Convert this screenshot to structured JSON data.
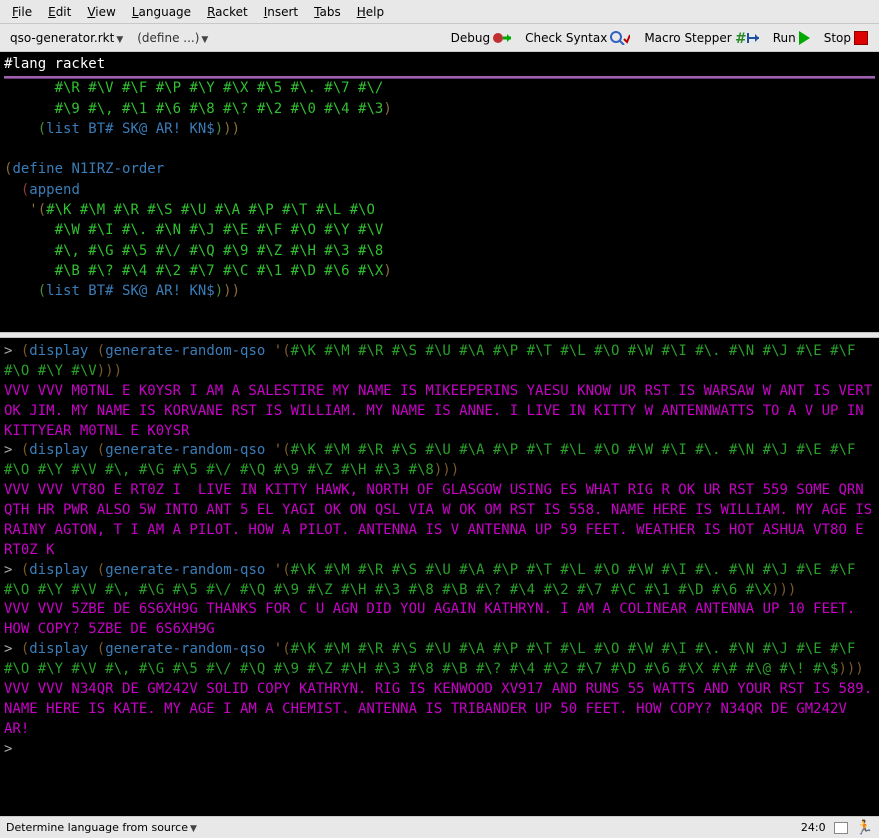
{
  "menubar": {
    "items": [
      {
        "label": "File",
        "accel": "F"
      },
      {
        "label": "Edit",
        "accel": "E"
      },
      {
        "label": "View",
        "accel": "V"
      },
      {
        "label": "Language",
        "accel": "L"
      },
      {
        "label": "Racket",
        "accel": "R"
      },
      {
        "label": "Insert",
        "accel": "I"
      },
      {
        "label": "Tabs",
        "accel": "T"
      },
      {
        "label": "Help",
        "accel": "H"
      }
    ]
  },
  "toolbar": {
    "filename": "qso-generator.rkt",
    "definitions_picker": "(define ...)",
    "buttons": {
      "debug": "Debug",
      "check_syntax": "Check Syntax",
      "macro_stepper": "Macro Stepper",
      "run": "Run",
      "stop": "Stop"
    }
  },
  "definitions": {
    "hashlang": "#lang racket",
    "lines": [
      {
        "indent": "      ",
        "chars": "#\\R #\\V #\\F #\\P #\\Y #\\X #\\5 #\\. #\\7 #\\/"
      },
      {
        "indent": "      ",
        "chars": "#\\9 #\\, #\\1 #\\6 #\\8 #\\? #\\2 #\\0 #\\4 #\\3",
        "close": ")"
      },
      {
        "indent": "    ",
        "listcall": "(list BT# SK@ AR! KN$)",
        "close": "))"
      },
      {
        "blank": true
      },
      {
        "define_open": "(",
        "define_kw": "define",
        "define_id": " N1IRZ-order"
      },
      {
        "indent": "  ",
        "append_open": "(",
        "append_kw": "append"
      },
      {
        "indent": "   ",
        "quote": "'(",
        "chars": "#\\K #\\M #\\R #\\S #\\U #\\A #\\P #\\T #\\L #\\O"
      },
      {
        "indent": "      ",
        "chars": "#\\W #\\I #\\. #\\N #\\J #\\E #\\F #\\O #\\Y #\\V"
      },
      {
        "indent": "      ",
        "chars": "#\\, #\\G #\\5 #\\/ #\\Q #\\9 #\\Z #\\H #\\3 #\\8"
      },
      {
        "indent": "      ",
        "chars": "#\\B #\\? #\\4 #\\2 #\\7 #\\C #\\1 #\\D #\\6 #\\X",
        "close": ")"
      },
      {
        "indent": "    ",
        "listcall": "(list BT# SK@ AR! KN$)",
        "close": "))"
      }
    ]
  },
  "interactions": {
    "entries": [
      {
        "input_prefix": "(display (generate-random-qso '(",
        "input_chars": "#\\K #\\M #\\R #\\S #\\U #\\A #\\P #\\T #\\L #\\O #\\W #\\I #\\. #\\N #\\J #\\E #\\F #\\O #\\Y #\\V",
        "input_close": ")))",
        "output": "VVV VVV M0TNL E K0YSR I AM A SALESTIRE MY NAME IS MIKEEPERINS YAESU KNOW UR RST IS WARSAW W ANT IS VERT OK JIM. MY NAME IS KORVANE RST IS WILLIAM. MY NAME IS ANNE. I LIVE IN KITTY W ANTENNWATTS TO A V UP IN KITTYEAR M0TNL E K0YSR"
      },
      {
        "input_prefix": "(display (generate-random-qso '(",
        "input_chars": "#\\K #\\M #\\R #\\S #\\U #\\A #\\P #\\T #\\L #\\O #\\W #\\I #\\. #\\N #\\J #\\E #\\F #\\O #\\Y #\\V #\\, #\\G #\\5 #\\/ #\\Q #\\9 #\\Z #\\H #\\3 #\\8",
        "input_close": ")))",
        "output": "VVV VVV VT8O E RT0Z I  LIVE IN KITTY HAWK, NORTH OF GLASGOW USING ES WHAT RIG R OK UR RST 559 SOME QRN QTH HR PWR ALSO 5W INTO ANT 5 EL YAGI OK ON QSL VIA W OK OM RST IS 558. NAME HERE IS WILLIAM. MY AGE IS RAINY AGTON, T I AM A PILOT. HOW A PILOT. ANTENNA IS V ANTENNA UP 59 FEET. WEATHER IS HOT ASHUA VT8O E RT0Z K"
      },
      {
        "input_prefix": "(display (generate-random-qso '(",
        "input_chars": "#\\K #\\M #\\R #\\S #\\U #\\A #\\P #\\T #\\L #\\O #\\W #\\I #\\. #\\N #\\J #\\E #\\F #\\O #\\Y #\\V #\\, #\\G #\\5 #\\/ #\\Q #\\9 #\\Z #\\H #\\3 #\\8 #\\B #\\? #\\4 #\\2 #\\7 #\\C #\\1 #\\D #\\6 #\\X",
        "input_close": ")))",
        "output": "VVV VVV 5ZBE DE 6S6XH9G THANKS FOR C U AGN DID YOU AGAIN KATHRYN. I AM A COLINEAR ANTENNA UP 10 FEET. HOW COPY? 5ZBE DE 6S6XH9G"
      },
      {
        "input_prefix": "(display (generate-random-qso '(",
        "input_chars": "#\\K #\\M #\\R #\\S #\\U #\\A #\\P #\\T #\\L #\\O #\\W #\\I #\\. #\\N #\\J #\\E #\\F #\\O #\\Y #\\V #\\, #\\G #\\5 #\\/ #\\Q #\\9 #\\Z #\\H #\\3 #\\8 #\\B #\\? #\\4 #\\2 #\\7 #\\D #\\6 #\\X #\\# #\\@ #\\! #\\$",
        "input_close": ")))",
        "output": "VVV VVV N34QR DE GM242V SOLID COPY KATHRYN. RIG IS KENWOOD XV917 AND RUNS 55 WATTS AND YOUR RST IS 589. NAME HERE IS KATE. MY AGE I AM A CHEMIST. ANTENNA IS TRIBANDER UP 50 FEET. HOW COPY? N34QR DE GM242V AR!"
      }
    ],
    "final_prompt": ">"
  },
  "statusbar": {
    "language": "Determine language from source",
    "position": "24:0"
  },
  "colors": {
    "keyword": "#3a7db8",
    "char": "#30c030",
    "output": "#c800c8",
    "paren": "#8b6d3a"
  }
}
